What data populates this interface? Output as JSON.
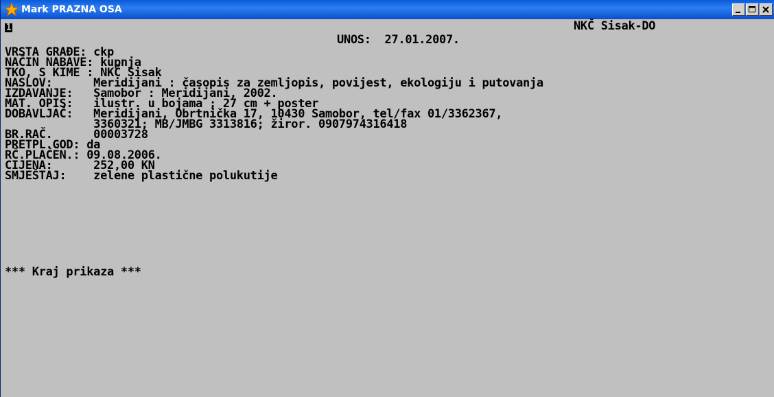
{
  "window": {
    "title": "Mark PRAZNA OSA",
    "icon": "star-icon",
    "controls": [
      "minimize-icon",
      "maximize-icon",
      "close-icon"
    ]
  },
  "console": {
    "record_number": "1",
    "institution": "NKČ Sisak-DO",
    "entry_header": "UNOS:  27.01.2007.",
    "lines": [
      "VRSTA GRAĐE: ckp",
      "NAČIN NABAVE: kupnja",
      "TKO, S KIME : NKČ Sisak",
      "NASLOV:      Meridijani : časopis za zemljopis, povijest, ekologiju i putovanja",
      "IZDAVANJE:   Samobor : Meridijani, 2002.",
      "MAT. OPIS:   ilustr. u bojama ; 27 cm + poster",
      "DOBAVLJAČ:   Meridijani, Obrtnička 17, 10430 Samobor, tel/fax 01/3362367,",
      "             3360321; MB/JMBG 3313816; žiror. 0907974316418",
      "BR.RAČ.      00003728",
      "PRETPL.GOD: da",
      "RČ.PLAĆEN.: 09.08.2006.",
      "CIJENA:      252,00 KN",
      "SMJEŠTAJ:    zelene plastične polukutije",
      "",
      "*** Kraj prikaza ***"
    ]
  }
}
